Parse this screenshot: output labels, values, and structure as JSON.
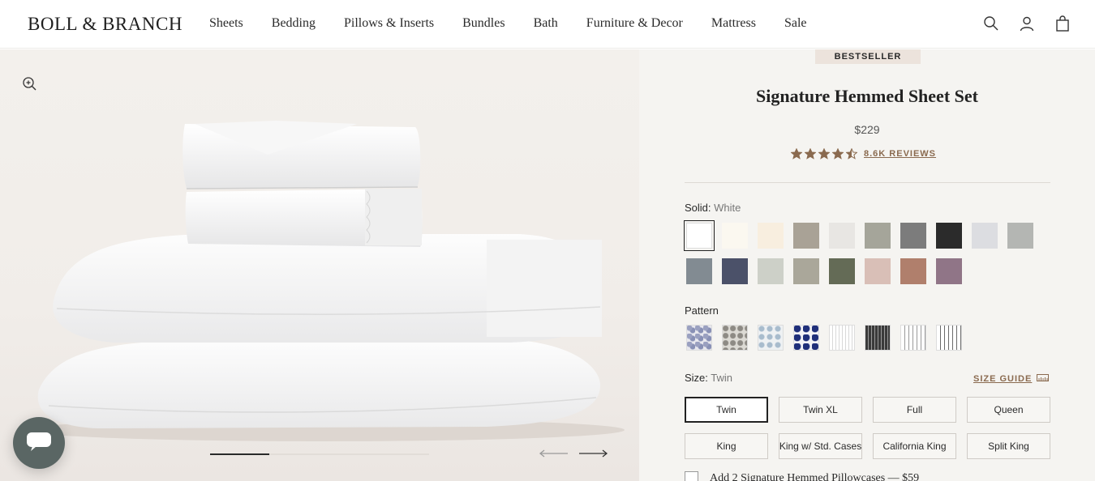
{
  "header": {
    "logo": "BOLL & BRANCH",
    "nav": [
      "Sheets",
      "Bedding",
      "Pillows & Inserts",
      "Bundles",
      "Bath",
      "Furniture & Decor",
      "Mattress",
      "Sale"
    ],
    "icons": [
      "search-icon",
      "account-icon",
      "cart-icon"
    ]
  },
  "gallery": {
    "progress": 0.27
  },
  "product": {
    "badge": "BESTSELLER",
    "title": "Signature Hemmed Sheet Set",
    "price": "$229",
    "rating": 4.5,
    "reviews": "8.6K REVIEWS",
    "solid_label": "Solid:",
    "solid_value": "White",
    "solid_colors": [
      "#ffffff",
      "#fbf8f0",
      "#f8eedf",
      "#a9a296",
      "#e8e6e3",
      "#a5a59a",
      "#7c7c7c",
      "#2b2b2b",
      "#dcdde1",
      "#b4b6b3",
      "#828b92",
      "#4b5169",
      "#cdd0c8",
      "#aaa79a",
      "#646b56",
      "#d9bfb7",
      "#b07f6c",
      "#907587"
    ],
    "pattern_label": "Pattern",
    "size_label": "Size:",
    "size_value": "Twin",
    "size_guide": "SIZE GUIDE",
    "sizes": [
      "Twin",
      "Twin XL",
      "Full",
      "Queen",
      "King",
      "King w/ Std. Cases",
      "California King",
      "Split King"
    ],
    "addon": "Add 2 Signature Hemmed Pillowcases —  $59"
  },
  "colors": {
    "accent": "#8a6a4f",
    "badge_bg": "#ece3dc",
    "panel_bg": "#f5f4f1",
    "star": "#8a6a4f",
    "chat_bg": "#5a6664"
  }
}
